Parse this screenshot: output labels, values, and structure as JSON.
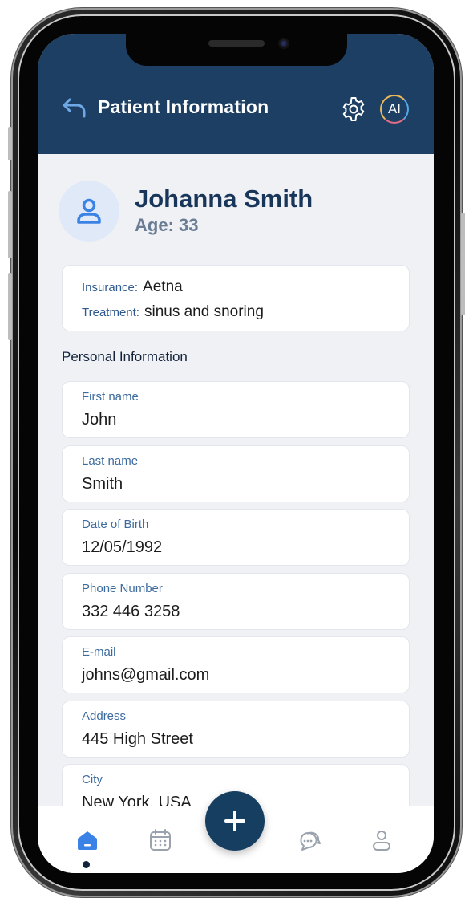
{
  "header": {
    "title": "Patient Information",
    "ai_label": "AI",
    "bg_color": "#1d3f63"
  },
  "patient": {
    "name": "Johanna Smith",
    "age": "Age: 33"
  },
  "summary": {
    "insurance_label": "Insurance:",
    "insurance_value": "Aetna",
    "treatment_label": "Treatment:",
    "treatment_value": "sinus and snoring"
  },
  "personal": {
    "title": "Personal Information",
    "fields": [
      {
        "label": "First name",
        "value": "John"
      },
      {
        "label": "Last name",
        "value": "Smith"
      },
      {
        "label": "Date of Birth",
        "value": "12/05/1992"
      },
      {
        "label": "Phone Number",
        "value": "332 446 3258"
      },
      {
        "label": "E-mail",
        "value": "johns@gmail.com"
      },
      {
        "label": "Address",
        "value": "445 High Street"
      },
      {
        "label": "City",
        "value": "New York, USA"
      }
    ]
  },
  "nav": {
    "items": [
      "home-icon",
      "calendar-icon",
      "add-icon",
      "chat-icon",
      "profile-icon"
    ],
    "active": "home-icon",
    "accent_color": "#3b82e6"
  }
}
